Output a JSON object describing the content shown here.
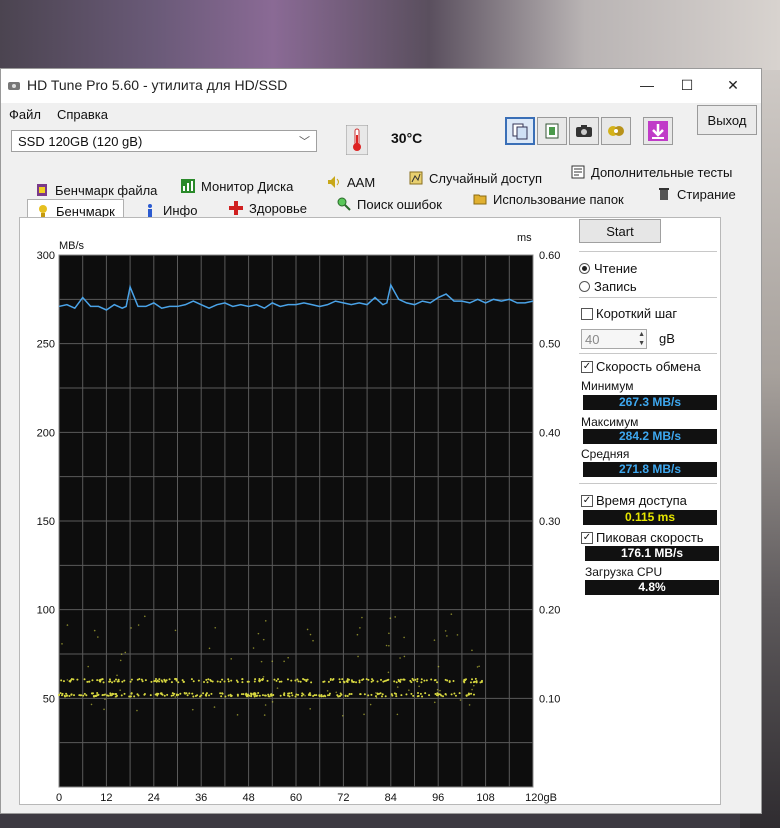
{
  "window": {
    "title": "HD Tune Pro 5.60 - утилита для HD/SSD",
    "minimize": "—",
    "maximize": "☐",
    "close": "✕"
  },
  "menu": {
    "file": "Файл",
    "help": "Справка"
  },
  "toolbar": {
    "drive": "SSD 120GB (120 gB)",
    "temperature": "30°C",
    "exit": "Выход"
  },
  "tabs_row1": [
    {
      "label": "Бенчмарк файла",
      "icon": "file-benchmark-icon"
    },
    {
      "label": "Монитор Диска",
      "icon": "disk-monitor-icon"
    },
    {
      "label": "AAM",
      "icon": "speaker-icon"
    },
    {
      "label": "Случайный доступ",
      "icon": "random-access-icon"
    },
    {
      "label": "Дополнительные  тесты",
      "icon": "extra-tests-icon"
    }
  ],
  "tabs_row2": [
    {
      "label": "Бенчмарк",
      "icon": "benchmark-icon"
    },
    {
      "label": "Инфо",
      "icon": "info-icon"
    },
    {
      "label": "Здоровье",
      "icon": "health-cross-icon"
    },
    {
      "label": "Поиск ошибок",
      "icon": "magnifier-icon"
    },
    {
      "label": "Использование папок",
      "icon": "folder-icon"
    },
    {
      "label": "Стирание",
      "icon": "trash-icon"
    }
  ],
  "controls": {
    "start": "Start",
    "read": "Чтение",
    "write": "Запись",
    "short_stroke": "Короткий шаг",
    "short_stroke_value": "40",
    "short_stroke_unit": "gB",
    "transfer_rate": "Скорость обмена",
    "min_label": "Минимум",
    "min_value": "267.3 MB/s",
    "max_label": "Максимум",
    "max_value": "284.2 MB/s",
    "avg_label": "Средняя",
    "avg_value": "271.8 MB/s",
    "access_time": "Время доступа",
    "access_time_value": "0.115 ms",
    "burst_rate": "Пиковая скорость",
    "burst_rate_value": "176.1 MB/s",
    "cpu_label": "Загрузка CPU",
    "cpu_value": "4.8%"
  },
  "colors": {
    "transfer_line": "#4aa3e8",
    "access_dots": "#d8d840",
    "plot_bg": "#0d0d0d",
    "min_max_avg_text": "#3ea8f0",
    "access_text": "#e6e600",
    "burst_text": "#ffffff",
    "cpu_text": "#ffffff"
  },
  "chart_data": {
    "type": "line",
    "ylabel_left": "MB/s",
    "ylabel_right": "ms",
    "xunit": "gB",
    "x_ticks": [
      "0",
      "12",
      "24",
      "36",
      "48",
      "60",
      "72",
      "84",
      "96",
      "108",
      "120gB"
    ],
    "y_left_ticks": [
      "300",
      "250",
      "200",
      "150",
      "100",
      "50"
    ],
    "y_right_ticks": [
      "0.60",
      "0.50",
      "0.40",
      "0.30",
      "0.20",
      "0.10"
    ],
    "ylim_left": [
      0,
      300
    ],
    "ylim_right": [
      0,
      0.6
    ],
    "xlim": [
      0,
      120
    ],
    "grid": true,
    "series": [
      {
        "x": [
          0,
          2,
          4,
          6,
          8,
          10,
          12,
          14,
          16,
          17,
          18,
          20,
          22,
          24,
          26,
          28,
          30,
          32,
          34,
          36,
          38,
          40,
          42,
          44,
          46,
          48,
          50,
          52,
          54,
          56,
          58,
          60,
          62,
          64,
          66,
          68,
          70,
          72,
          74,
          76,
          78,
          80,
          82,
          83,
          84,
          86,
          88,
          90,
          92,
          94,
          96,
          98,
          100,
          102,
          104,
          106,
          108,
          110,
          112,
          114,
          116,
          118,
          120
        ],
        "y": [
          271,
          272,
          270,
          276,
          271,
          271,
          269,
          272,
          270,
          271,
          282,
          271,
          271,
          273,
          270,
          271,
          271,
          272,
          274,
          272,
          270,
          272,
          273,
          271,
          272,
          271,
          272,
          270,
          273,
          271,
          272,
          272,
          273,
          272,
          271,
          272,
          274,
          273,
          272,
          273,
          272,
          276,
          272,
          273,
          283,
          275,
          273,
          272,
          274,
          273,
          276,
          278,
          274,
          274,
          273,
          275,
          273,
          275,
          274,
          275,
          273,
          273,
          274
        ]
      }
    ],
    "access_time_ms": {
      "band_main": 0.104,
      "band_upper": 0.12,
      "spread_min": 0.08,
      "spread_max": 0.2
    }
  }
}
